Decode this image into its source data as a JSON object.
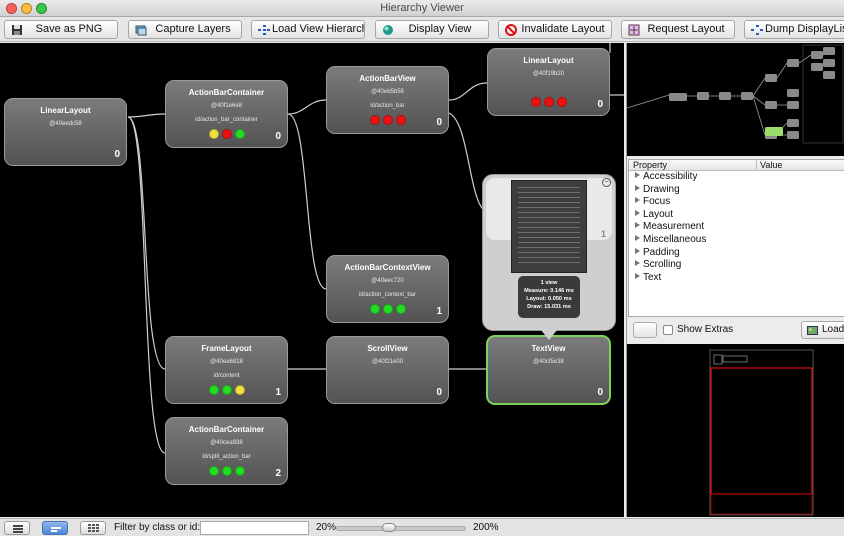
{
  "window": {
    "title": "Hierarchy Viewer"
  },
  "toolbar": {
    "save_png": "Save as PNG",
    "capture_layers": "Capture Layers",
    "load_view_hierarchy": "Load View Hierarchy",
    "display_view": "Display View",
    "invalidate_layout": "Invalidate Layout",
    "request_layout": "Request Layout",
    "dump_displaylist": "Dump DisplayList"
  },
  "status_colors": {
    "green": "#22dd22",
    "yellow": "#f0e040",
    "red": "#ee1111"
  },
  "nodes": [
    {
      "name": "LinearLayout",
      "hash": "@40eedc58",
      "id": "",
      "count": "0",
      "dots": []
    },
    {
      "name": "ActionBarContainer",
      "hash": "@40f1e6e8",
      "id": "id/action_bar_container",
      "count": "0",
      "dots": [
        "yellow",
        "red",
        "green"
      ]
    },
    {
      "name": "ActionBarView",
      "hash": "@40eb5b58",
      "id": "id/action_bar",
      "count": "0",
      "dots": [
        "red",
        "red",
        "red"
      ]
    },
    {
      "name": "LinearLayout",
      "hash": "@40f19b20",
      "id": "",
      "count": "0",
      "dots": [
        "red",
        "red",
        "red"
      ]
    },
    {
      "name": "ActionBarContextView",
      "hash": "@40eec720",
      "id": "id/action_context_bar",
      "count": "1",
      "dots": [
        "green",
        "green",
        "green"
      ]
    },
    {
      "name": "FrameLayout",
      "hash": "@40ea6818",
      "id": "id/content",
      "count": "1",
      "dots": [
        "green",
        "green",
        "yellow"
      ]
    },
    {
      "name": "ScrollView",
      "hash": "@40f21e00",
      "id": "",
      "count": "0",
      "dots": []
    },
    {
      "name": "TextView",
      "hash": "@40cf5e38",
      "id": "",
      "count": "0",
      "dots": []
    },
    {
      "name": "ActionBarContainer",
      "hash": "@40cea938",
      "id": "id/split_action_bar",
      "count": "2",
      "dots": [
        "green",
        "green",
        "green"
      ]
    }
  ],
  "popup": {
    "views": "1 view",
    "measure": "Measure: 0.146 ms",
    "layout": "Layout: 0.050 ms",
    "draw": "Draw: 15.031 ms",
    "count": "1"
  },
  "properties": {
    "col_property": "Property",
    "col_value": "Value",
    "categories": [
      "Accessibility",
      "Drawing",
      "Focus",
      "Layout",
      "Measurement",
      "Miscellaneous",
      "Padding",
      "Scrolling",
      "Text"
    ]
  },
  "extras": {
    "show_extras": "Show Extras",
    "load": "Load"
  },
  "statusbar": {
    "filter_label": "Filter by class or id:",
    "filter_value": "",
    "zoom_min": "20%",
    "zoom_max": "200%",
    "zoom_level": 0.4
  }
}
